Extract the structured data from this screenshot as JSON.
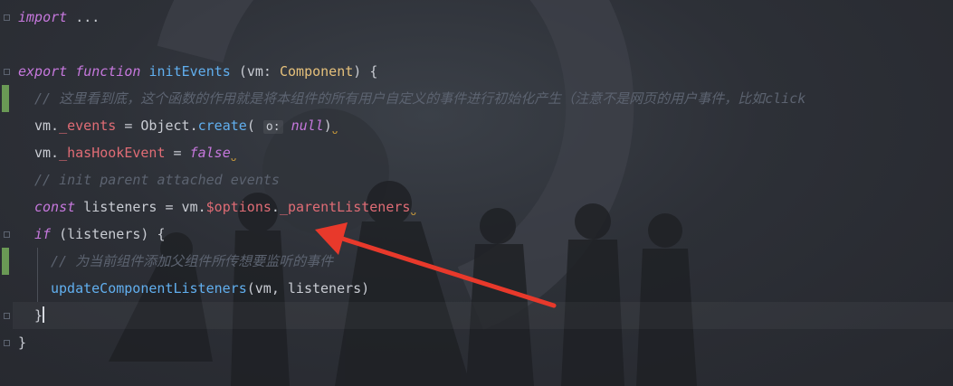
{
  "editor": {
    "lines": {
      "l1": {
        "kw": "import",
        "rest": " ..."
      },
      "l2": {
        "kw_export": "export",
        "kw_function": "function",
        "fn": "initEvents",
        "open": " (vm: ",
        "type": "Component",
        "close": ") {"
      },
      "l3": {
        "comment": "// 这里看到底，这个函数的作用就是将本组件的所有用户自定义的事件进行初始化产生（注意不是网页的用户事件，比如click"
      },
      "l4": {
        "obj": "vm.",
        "prop": "_events",
        "mid": " = Object.",
        "method": "create",
        "paren": "( ",
        "hint": "o:",
        "lit": "null",
        "end": ")"
      },
      "l5": {
        "obj": "vm.",
        "prop": "_hasHookEvent",
        "mid": " = ",
        "lit": "false"
      },
      "l6": {
        "comment": "// init parent attached events"
      },
      "l7": {
        "kw": "const",
        "mid": " listeners = vm.",
        "prop1": "$options",
        "dot": ".",
        "prop2": "_parentListeners"
      },
      "l8": {
        "kw": "if",
        "rest": " (listeners) {"
      },
      "l9": {
        "comment": "// 为当前组件添加父组件所传想要监听的事件"
      },
      "l10": {
        "fn": "updateComponentListeners",
        "rest": "(vm, listeners)"
      },
      "l11": {
        "brace": "}"
      },
      "l12": {
        "brace": "}"
      }
    },
    "squiggle": "ᴗ"
  },
  "colors": {
    "annotation_arrow": "#e8392b",
    "change_marker": "#6a9955"
  }
}
